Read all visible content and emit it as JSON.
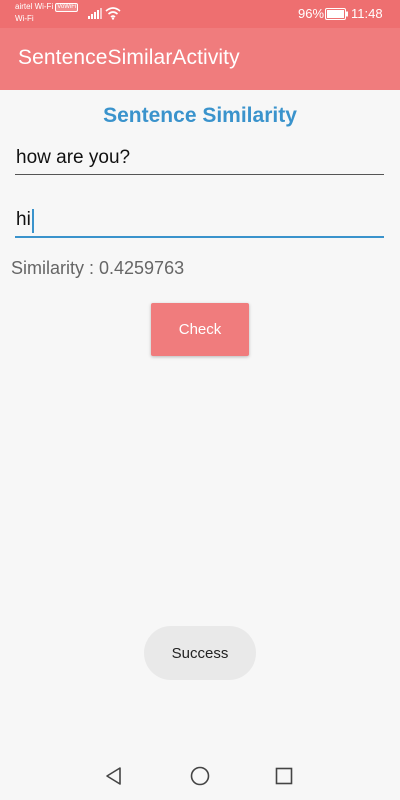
{
  "status_bar": {
    "carrier": "airtel Wi-Fi",
    "volte_badge": "VoWiFi",
    "network": "Wi-Fi",
    "battery_percent": "96%",
    "time": "11:48",
    "icons": [
      "signal-icon",
      "wifi-icon",
      "battery-icon"
    ]
  },
  "app_bar": {
    "title": "SentenceSimilarActivity",
    "color": "#f07c7d"
  },
  "main": {
    "heading": "Sentence Similarity",
    "heading_color": "#3a93cc",
    "sentence_1": "how are you?",
    "sentence_2": "hi",
    "similarity_text": "Similarity : 0.4259763",
    "check_label": "Check"
  },
  "toast": {
    "message": "Success"
  },
  "nav_bar": {
    "icons": [
      "back-icon",
      "home-icon",
      "recent-apps-icon"
    ]
  }
}
